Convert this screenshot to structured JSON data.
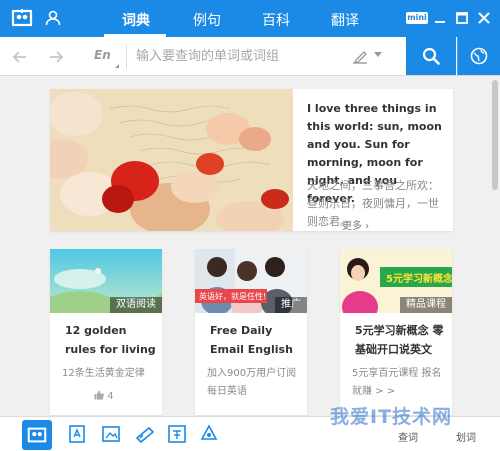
{
  "titlebar": {
    "tabs": [
      {
        "label": "词典",
        "active": true
      },
      {
        "label": "例句",
        "active": false
      },
      {
        "label": "百科",
        "active": false
      },
      {
        "label": "翻译",
        "active": false
      }
    ],
    "mini_label": "mini",
    "accent_color": "#1b8ae6"
  },
  "search": {
    "lang": "En",
    "placeholder": "输入要查询的单词或词组",
    "value": ""
  },
  "hero": {
    "english": "I love three things in this world: sun, moon and you. Sun for morning, moon for night, and you forever.",
    "chinese": "天地之间，三事吾之所欢：昼则乐日，夜则慵月，一世则恋君。",
    "more": "更多 ›"
  },
  "cards": [
    {
      "tag": "双语阅读",
      "title": "12 golden rules for living",
      "subtitle": "12条生活黄金定律",
      "likes": "4"
    },
    {
      "tag": "推广",
      "title": "Free Daily Email English",
      "subtitle": "加入900万用户订阅每日英语",
      "likes": ""
    },
    {
      "tag": "精品课程",
      "title": "5元学习新概念 零基础开口说英文",
      "subtitle": "5元享百元课程 报名就赚 > >",
      "likes": ""
    }
  ],
  "card_images": {
    "card2_text": "英语好，就是任性!",
    "card3_text": "5元学习新概念"
  },
  "bottombar": {
    "label_a": "查词",
    "label_b": "划词"
  },
  "watermark": "我爱IT技术网"
}
